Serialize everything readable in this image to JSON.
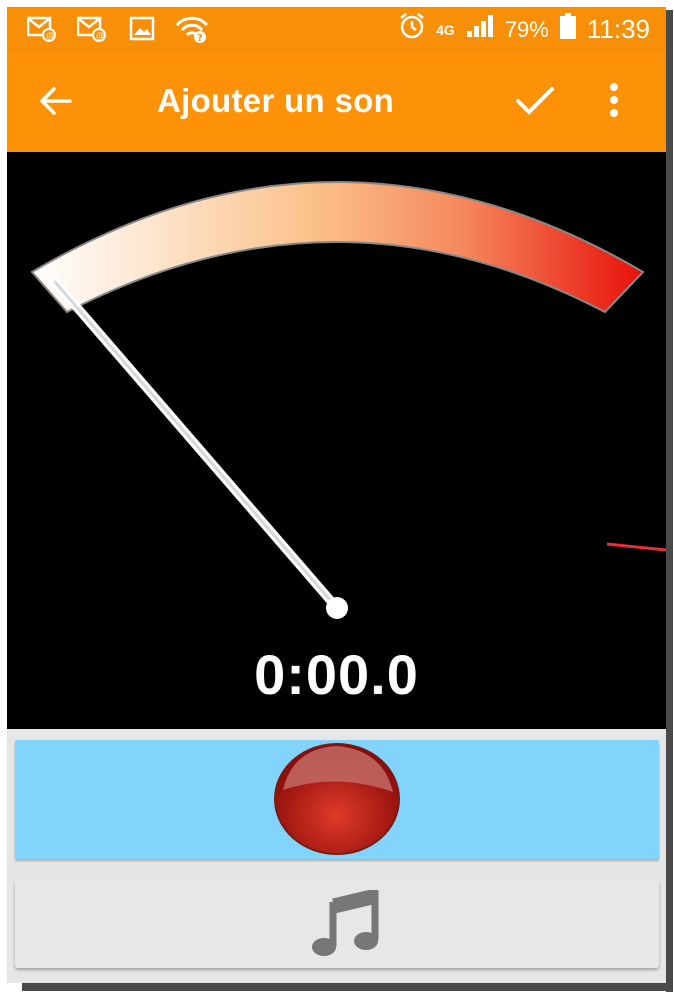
{
  "status_bar": {
    "battery_percent": "79%",
    "time": "11:39",
    "network": "4G",
    "icons": [
      "email-icon",
      "email-icon",
      "gallery-icon",
      "wifi-icon",
      "alarm-icon",
      "signal-icon",
      "battery-icon"
    ]
  },
  "app_bar": {
    "title": "Ajouter un son",
    "icons": [
      "back-arrow-icon",
      "check-icon",
      "more-vert-icon"
    ]
  },
  "meter": {
    "level": 0,
    "colors": {
      "low": "#ffffff",
      "mid": "#f8a56a",
      "high": "#e8150d"
    }
  },
  "timer": "0:00.0",
  "record": {
    "icon": "record-icon",
    "color": "#b8231c"
  },
  "music": {
    "icon": "music-note-icon"
  },
  "colors": {
    "accent": "#fd9208",
    "record_panel": "#82d4fd",
    "music_panel": "#e7e7e7"
  }
}
